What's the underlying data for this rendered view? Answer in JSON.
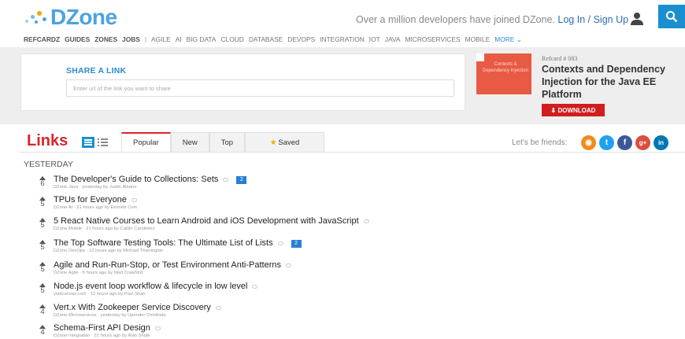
{
  "header": {
    "logo_text": "DZone",
    "tagline": "Over a million developers have joined DZone.",
    "login": "Log In",
    "slash": " / ",
    "signup": "Sign Up",
    "accent": "#1a8fd0",
    "brand_color": "#4aa3df"
  },
  "nav": {
    "items": [
      "REFCARDZ",
      "GUIDES",
      "ZONES",
      "JOBS",
      "|",
      "AGILE",
      "AI",
      "BIG DATA",
      "CLOUD",
      "DATABASE",
      "DEVOPS",
      "INTEGRATION",
      "IOT",
      "JAVA",
      "MICROSERVICES",
      "MOBILE"
    ],
    "more": "MORE ⌄"
  },
  "share": {
    "title": "SHARE A LINK",
    "placeholder": "Enter url of the link you want to share"
  },
  "refcard": {
    "image_text": "Contexts & Dependency Injection",
    "number": "Refcard # 083",
    "title": "Contexts and Dependency Injection for the Java EE Platform",
    "download": "⬇ DOWNLOAD"
  },
  "links": {
    "title": "Links",
    "tabs": [
      "Popular",
      "New",
      "Top",
      "Saved"
    ],
    "active_tab": "Popular",
    "friends_label": "Let's be friends:",
    "section": "YESTERDAY",
    "items": [
      {
        "votes": "6",
        "title": "The Developer's Guide to Collections: Sets",
        "meta": "DZone Java · yesterday by Justin Albano",
        "comments": "2"
      },
      {
        "votes": "5",
        "title": "TPUs for Everyone",
        "meta": "DZone AI · 21 hours ago by Emmett Coin",
        "comments": ""
      },
      {
        "votes": "5",
        "title": "5 React Native Courses to Learn Android and iOS Development with JavaScript",
        "meta": "DZone Mobile · 21 hours ago by Caitlin Candelmo",
        "comments": ""
      },
      {
        "votes": "5",
        "title": "The Top Software Testing Tools: The Ultimate List of Lists",
        "meta": "DZone DevOps · 12 hours ago by Michael Tharrington",
        "comments": "2"
      },
      {
        "votes": "5",
        "title": "Agile and Run-Run-Stop, or Test Environment Anti-Patterns",
        "meta": "DZone Agile · 6 hours ago by Niall Crawford",
        "comments": ""
      },
      {
        "votes": "5",
        "title": "Node.js event loop workflow & lifecycle in low level",
        "meta": "voidcanvas.com · 12 hours ago by Paul Shan",
        "comments": ""
      },
      {
        "votes": "4",
        "title": "Vert.x With Zookeeper Service Discovery",
        "meta": "DZone Microservices · yesterday by Upender Chinthala",
        "comments": ""
      },
      {
        "votes": "4",
        "title": "Schema-First API Design",
        "meta": "DZone Integration · 21 hours ago by Alan Shafe",
        "comments": ""
      }
    ]
  },
  "social": {
    "rss": {
      "glyph": "◉",
      "color": "#f48a1e"
    },
    "twitter": {
      "glyph": "t",
      "color": "#1da1f2"
    },
    "facebook": {
      "glyph": "f",
      "color": "#3b5998"
    },
    "gplus": {
      "glyph": "g+",
      "color": "#dc4e41"
    },
    "linkedin": {
      "glyph": "in",
      "color": "#0077b5"
    }
  }
}
